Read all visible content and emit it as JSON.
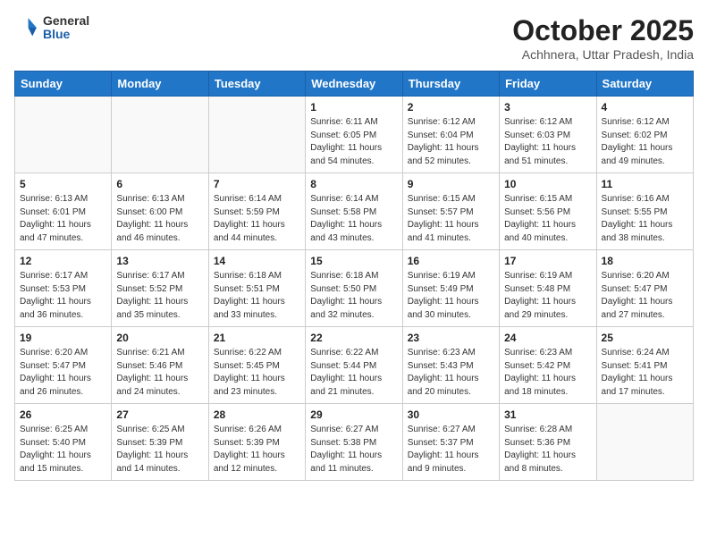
{
  "header": {
    "logo_general": "General",
    "logo_blue": "Blue",
    "title": "October 2025",
    "location": "Achhnera, Uttar Pradesh, India"
  },
  "calendar": {
    "weekdays": [
      "Sunday",
      "Monday",
      "Tuesday",
      "Wednesday",
      "Thursday",
      "Friday",
      "Saturday"
    ],
    "weeks": [
      [
        {
          "day": "",
          "info": ""
        },
        {
          "day": "",
          "info": ""
        },
        {
          "day": "",
          "info": ""
        },
        {
          "day": "1",
          "info": "Sunrise: 6:11 AM\nSunset: 6:05 PM\nDaylight: 11 hours\nand 54 minutes."
        },
        {
          "day": "2",
          "info": "Sunrise: 6:12 AM\nSunset: 6:04 PM\nDaylight: 11 hours\nand 52 minutes."
        },
        {
          "day": "3",
          "info": "Sunrise: 6:12 AM\nSunset: 6:03 PM\nDaylight: 11 hours\nand 51 minutes."
        },
        {
          "day": "4",
          "info": "Sunrise: 6:12 AM\nSunset: 6:02 PM\nDaylight: 11 hours\nand 49 minutes."
        }
      ],
      [
        {
          "day": "5",
          "info": "Sunrise: 6:13 AM\nSunset: 6:01 PM\nDaylight: 11 hours\nand 47 minutes."
        },
        {
          "day": "6",
          "info": "Sunrise: 6:13 AM\nSunset: 6:00 PM\nDaylight: 11 hours\nand 46 minutes."
        },
        {
          "day": "7",
          "info": "Sunrise: 6:14 AM\nSunset: 5:59 PM\nDaylight: 11 hours\nand 44 minutes."
        },
        {
          "day": "8",
          "info": "Sunrise: 6:14 AM\nSunset: 5:58 PM\nDaylight: 11 hours\nand 43 minutes."
        },
        {
          "day": "9",
          "info": "Sunrise: 6:15 AM\nSunset: 5:57 PM\nDaylight: 11 hours\nand 41 minutes."
        },
        {
          "day": "10",
          "info": "Sunrise: 6:15 AM\nSunset: 5:56 PM\nDaylight: 11 hours\nand 40 minutes."
        },
        {
          "day": "11",
          "info": "Sunrise: 6:16 AM\nSunset: 5:55 PM\nDaylight: 11 hours\nand 38 minutes."
        }
      ],
      [
        {
          "day": "12",
          "info": "Sunrise: 6:17 AM\nSunset: 5:53 PM\nDaylight: 11 hours\nand 36 minutes."
        },
        {
          "day": "13",
          "info": "Sunrise: 6:17 AM\nSunset: 5:52 PM\nDaylight: 11 hours\nand 35 minutes."
        },
        {
          "day": "14",
          "info": "Sunrise: 6:18 AM\nSunset: 5:51 PM\nDaylight: 11 hours\nand 33 minutes."
        },
        {
          "day": "15",
          "info": "Sunrise: 6:18 AM\nSunset: 5:50 PM\nDaylight: 11 hours\nand 32 minutes."
        },
        {
          "day": "16",
          "info": "Sunrise: 6:19 AM\nSunset: 5:49 PM\nDaylight: 11 hours\nand 30 minutes."
        },
        {
          "day": "17",
          "info": "Sunrise: 6:19 AM\nSunset: 5:48 PM\nDaylight: 11 hours\nand 29 minutes."
        },
        {
          "day": "18",
          "info": "Sunrise: 6:20 AM\nSunset: 5:47 PM\nDaylight: 11 hours\nand 27 minutes."
        }
      ],
      [
        {
          "day": "19",
          "info": "Sunrise: 6:20 AM\nSunset: 5:47 PM\nDaylight: 11 hours\nand 26 minutes."
        },
        {
          "day": "20",
          "info": "Sunrise: 6:21 AM\nSunset: 5:46 PM\nDaylight: 11 hours\nand 24 minutes."
        },
        {
          "day": "21",
          "info": "Sunrise: 6:22 AM\nSunset: 5:45 PM\nDaylight: 11 hours\nand 23 minutes."
        },
        {
          "day": "22",
          "info": "Sunrise: 6:22 AM\nSunset: 5:44 PM\nDaylight: 11 hours\nand 21 minutes."
        },
        {
          "day": "23",
          "info": "Sunrise: 6:23 AM\nSunset: 5:43 PM\nDaylight: 11 hours\nand 20 minutes."
        },
        {
          "day": "24",
          "info": "Sunrise: 6:23 AM\nSunset: 5:42 PM\nDaylight: 11 hours\nand 18 minutes."
        },
        {
          "day": "25",
          "info": "Sunrise: 6:24 AM\nSunset: 5:41 PM\nDaylight: 11 hours\nand 17 minutes."
        }
      ],
      [
        {
          "day": "26",
          "info": "Sunrise: 6:25 AM\nSunset: 5:40 PM\nDaylight: 11 hours\nand 15 minutes."
        },
        {
          "day": "27",
          "info": "Sunrise: 6:25 AM\nSunset: 5:39 PM\nDaylight: 11 hours\nand 14 minutes."
        },
        {
          "day": "28",
          "info": "Sunrise: 6:26 AM\nSunset: 5:39 PM\nDaylight: 11 hours\nand 12 minutes."
        },
        {
          "day": "29",
          "info": "Sunrise: 6:27 AM\nSunset: 5:38 PM\nDaylight: 11 hours\nand 11 minutes."
        },
        {
          "day": "30",
          "info": "Sunrise: 6:27 AM\nSunset: 5:37 PM\nDaylight: 11 hours\nand 9 minutes."
        },
        {
          "day": "31",
          "info": "Sunrise: 6:28 AM\nSunset: 5:36 PM\nDaylight: 11 hours\nand 8 minutes."
        },
        {
          "day": "",
          "info": ""
        }
      ]
    ]
  }
}
